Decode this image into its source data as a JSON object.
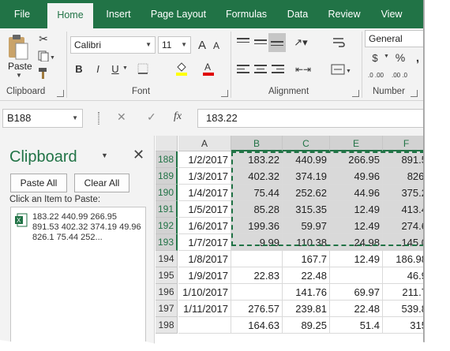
{
  "tabs": [
    "File",
    "Home",
    "Insert",
    "Page Layout",
    "Formulas",
    "Data",
    "Review",
    "View"
  ],
  "active_tab": "Home",
  "ribbon": {
    "clipboard": {
      "paste_label": "Paste",
      "group_label": "Clipboard"
    },
    "font": {
      "font_name": "Calibri",
      "font_size": "11",
      "grow_label": "A",
      "shrink_label": "A",
      "bold": "B",
      "italic": "I",
      "underline": "U",
      "group_label": "Font"
    },
    "alignment": {
      "group_label": "Alignment"
    },
    "number": {
      "format": "General",
      "currency": "$",
      "percent": "%",
      "comma": ",",
      "inc_decimals": ".0 .00",
      "dec_decimals": ".00 .0",
      "group_label": "Number"
    }
  },
  "formula_bar": {
    "name_box": "B188",
    "cancel": "✕",
    "enter": "✓",
    "fx": "fx",
    "value": "183.22"
  },
  "clipboard_pane": {
    "title": "Clipboard",
    "paste_all": "Paste All",
    "clear_all": "Clear All",
    "hint": "Click an Item to Paste:",
    "items": [
      "183.22 440.99 266.95 891.53 402.32 374.19 49.96 826.1 75.44 252..."
    ]
  },
  "sheet": {
    "columns": [
      "A",
      "B",
      "C",
      "E",
      "F"
    ],
    "rows": [
      {
        "num": "188",
        "cells": [
          "1/2/2017",
          "183.22",
          "440.99",
          "266.95",
          "891.5"
        ]
      },
      {
        "num": "189",
        "cells": [
          "1/3/2017",
          "402.32",
          "374.19",
          "49.96",
          "826."
        ]
      },
      {
        "num": "190",
        "cells": [
          "1/4/2017",
          "75.44",
          "252.62",
          "44.96",
          "375.2"
        ]
      },
      {
        "num": "191",
        "cells": [
          "1/5/2017",
          "85.28",
          "315.35",
          "12.49",
          "413.4"
        ]
      },
      {
        "num": "192",
        "cells": [
          "1/6/2017",
          "199.36",
          "59.97",
          "12.49",
          "274.6"
        ]
      },
      {
        "num": "193",
        "cells": [
          "1/7/2017",
          "9.99",
          "110.38",
          "24.98",
          "145.0"
        ]
      },
      {
        "num": "194",
        "cells": [
          "1/8/2017",
          "",
          "167.7",
          "12.49",
          "186.98"
        ]
      },
      {
        "num": "195",
        "cells": [
          "1/9/2017",
          "22.83",
          "22.48",
          "",
          "46.9"
        ]
      },
      {
        "num": "196",
        "cells": [
          "1/10/2017",
          "",
          "141.76",
          "69.97",
          "211.7"
        ]
      },
      {
        "num": "197",
        "cells": [
          "1/11/2017",
          "276.57",
          "239.81",
          "22.48",
          "539.8"
        ]
      },
      {
        "num": "198",
        "cells": [
          "",
          "164.63",
          "89.25",
          "51.4",
          "315"
        ]
      }
    ]
  },
  "colors": {
    "accent": "#217346",
    "selection": "#d9d9d9"
  }
}
